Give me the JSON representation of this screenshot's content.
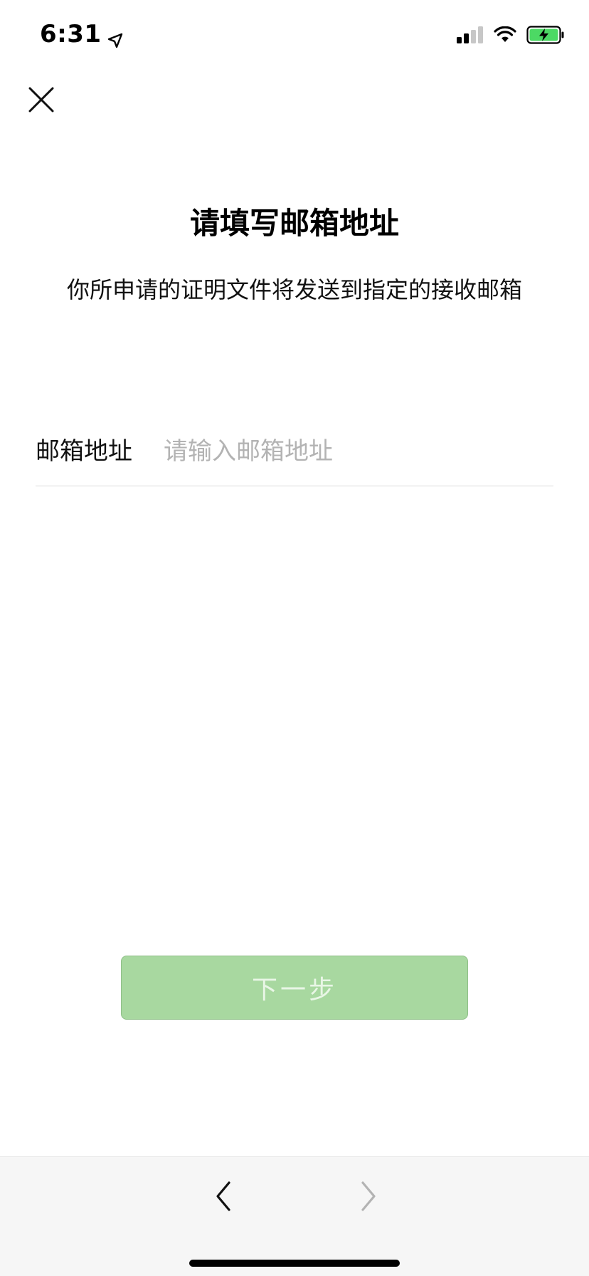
{
  "status_bar": {
    "time": "6:31",
    "location_icon": "location-arrow-icon",
    "signal_icon": "cellular-signal-icon",
    "wifi_icon": "wifi-icon",
    "battery_icon": "battery-charging-icon",
    "battery_color": "#4cd964"
  },
  "header": {
    "close_icon": "close-icon"
  },
  "content": {
    "title": "请填写邮箱地址",
    "subtitle": "你所申请的证明文件将发送到指定的接收邮箱"
  },
  "form": {
    "email_label": "邮箱地址",
    "email_value": "",
    "email_placeholder": "请输入邮箱地址"
  },
  "actions": {
    "next_label": "下一步",
    "next_color": "#a8d8a0"
  },
  "toolbar": {
    "back_icon": "chevron-left-icon",
    "forward_icon": "chevron-right-icon"
  }
}
